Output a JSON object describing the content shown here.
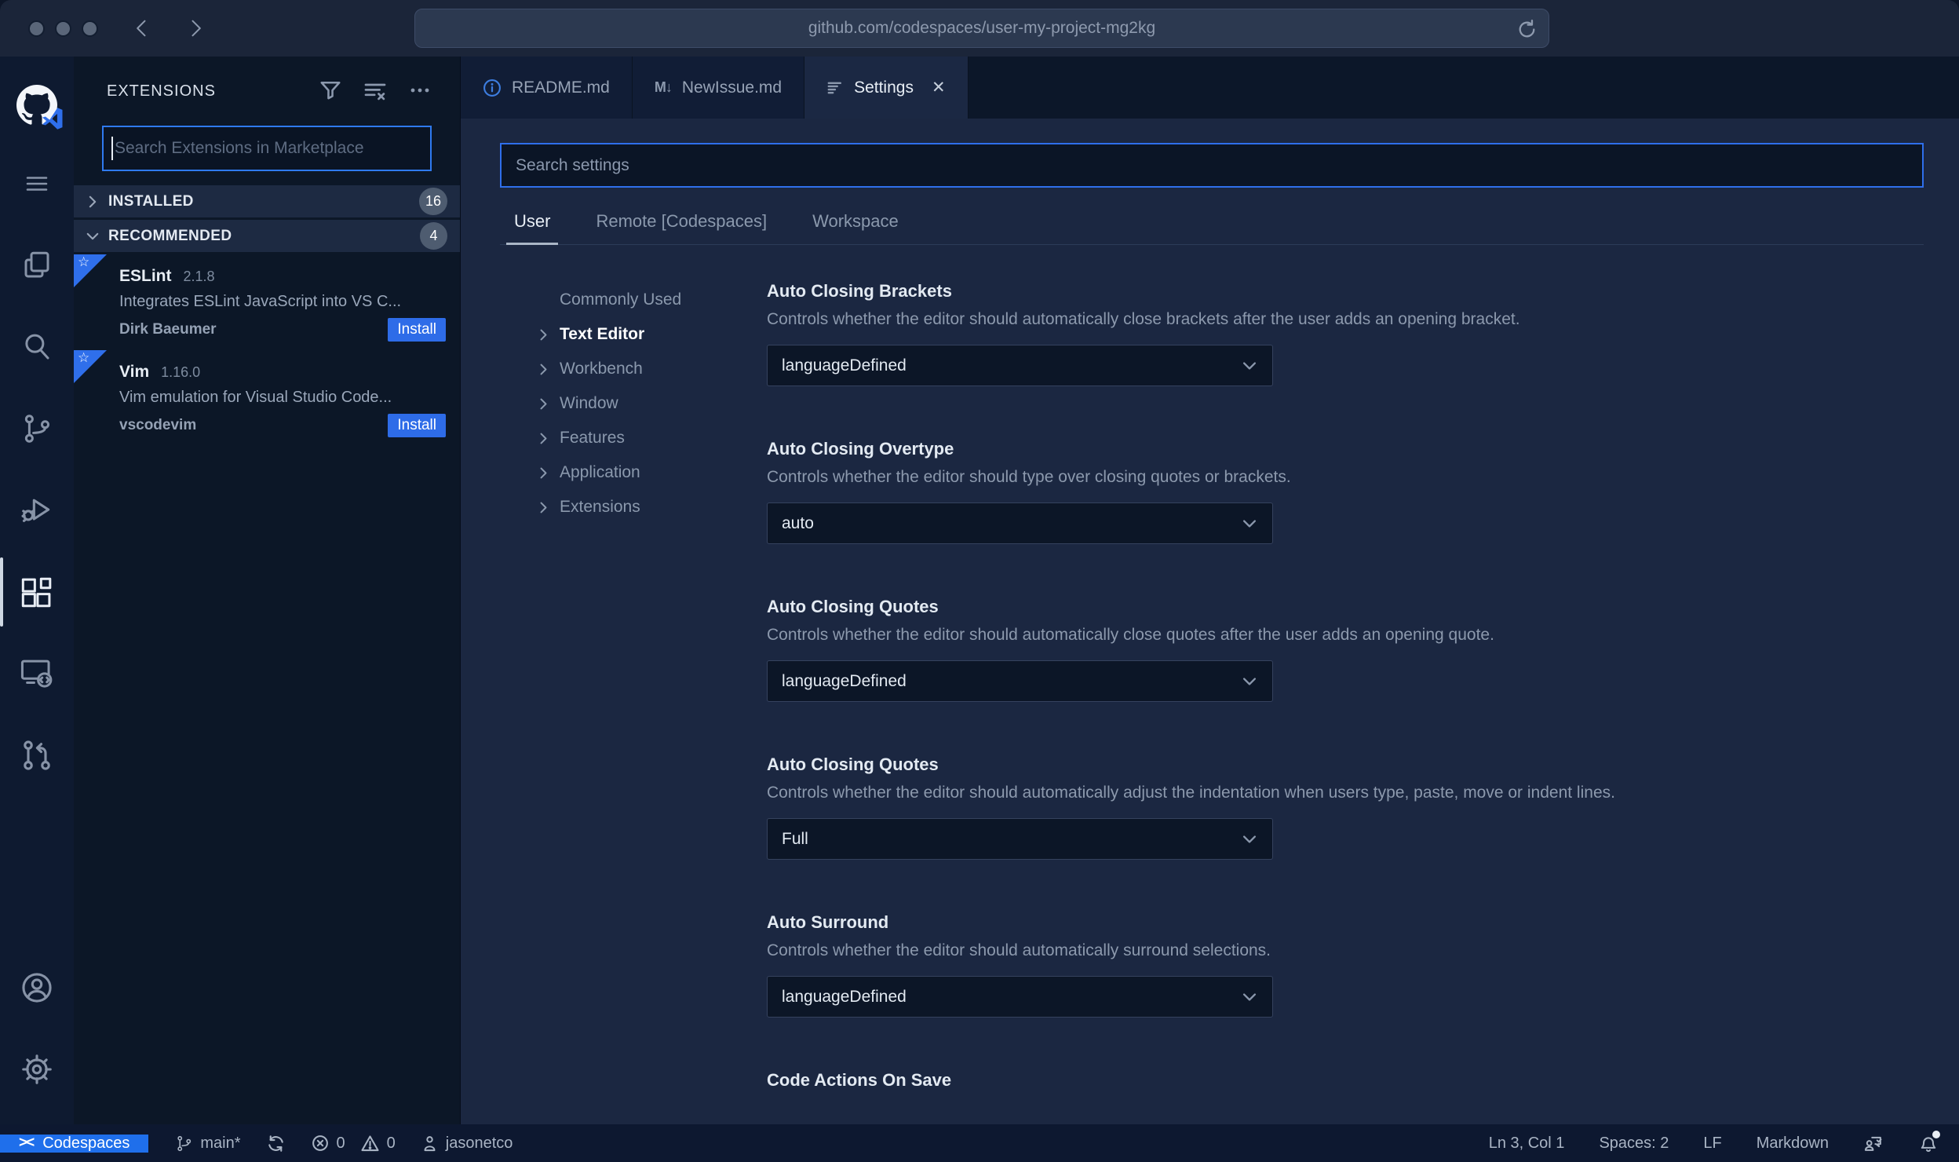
{
  "browser": {
    "url": "github.com/codespaces/user-my-project-mg2kg"
  },
  "sidebar": {
    "title": "EXTENSIONS",
    "search_placeholder": "Search Extensions in Marketplace",
    "sections": [
      {
        "label": "INSTALLED",
        "count": "16"
      },
      {
        "label": "RECOMMENDED",
        "count": "4"
      }
    ],
    "extensions": [
      {
        "name": "ESLint",
        "version": "2.1.8",
        "description": "Integrates ESLint JavaScript into VS C...",
        "author": "Dirk Baeumer",
        "action_label": "Install"
      },
      {
        "name": "Vim",
        "version": "1.16.0",
        "description": "Vim emulation for Visual Studio Code...",
        "author": "vscodevim",
        "action_label": "Install"
      }
    ],
    "ribbon_star": "☆"
  },
  "tabs": [
    {
      "label": "README.md"
    },
    {
      "label": "NewIssue.md",
      "icon_glyph": "M↓"
    },
    {
      "label": "Settings",
      "close_glyph": "✕"
    }
  ],
  "settings": {
    "search_placeholder": "Search settings",
    "scope_tabs": [
      {
        "label": "User"
      },
      {
        "label": "Remote [Codespaces]"
      },
      {
        "label": "Workspace"
      }
    ],
    "toc": [
      {
        "label": "Commonly Used"
      },
      {
        "label": "Text Editor"
      },
      {
        "label": "Workbench"
      },
      {
        "label": "Window"
      },
      {
        "label": "Features"
      },
      {
        "label": "Application"
      },
      {
        "label": "Extensions"
      }
    ],
    "items": [
      {
        "name": "Auto Closing Brackets",
        "description": "Controls whether the editor should automatically close brackets after the user adds an opening bracket.",
        "value": "languageDefined"
      },
      {
        "name": "Auto Closing Overtype",
        "description": "Controls whether the editor should type over closing quotes or brackets.",
        "value": "auto"
      },
      {
        "name": "Auto Closing Quotes",
        "description": "Controls whether the editor should automatically close quotes after the user adds an opening quote.",
        "value": "languageDefined"
      },
      {
        "name": "Auto Closing Quotes",
        "description": "Controls whether the editor should automatically adjust the indentation when users type, paste, move or indent lines.",
        "value": "Full"
      },
      {
        "name": "Auto Surround",
        "description": "Controls whether the editor should automatically surround selections.",
        "value": "languageDefined"
      },
      {
        "name": "Code Actions On Save"
      }
    ]
  },
  "status_bar": {
    "remote_label": "Codespaces",
    "remote_glyph": "><",
    "branch": "main*",
    "errors": "0",
    "warnings": "0",
    "user": "jasonetco",
    "cursor": "Ln 3, Col 1",
    "indent": "Spaces: 2",
    "eol": "LF",
    "language": "Markdown"
  },
  "colors": {
    "accent_blue": "#2f6feb",
    "statusbar_remote": "#1f6feb",
    "install_button": "#2e6ce8",
    "editor_bg": "#1b2741",
    "sidebar_bg": "#0c1727",
    "chrome_bg": "#1b2539"
  }
}
